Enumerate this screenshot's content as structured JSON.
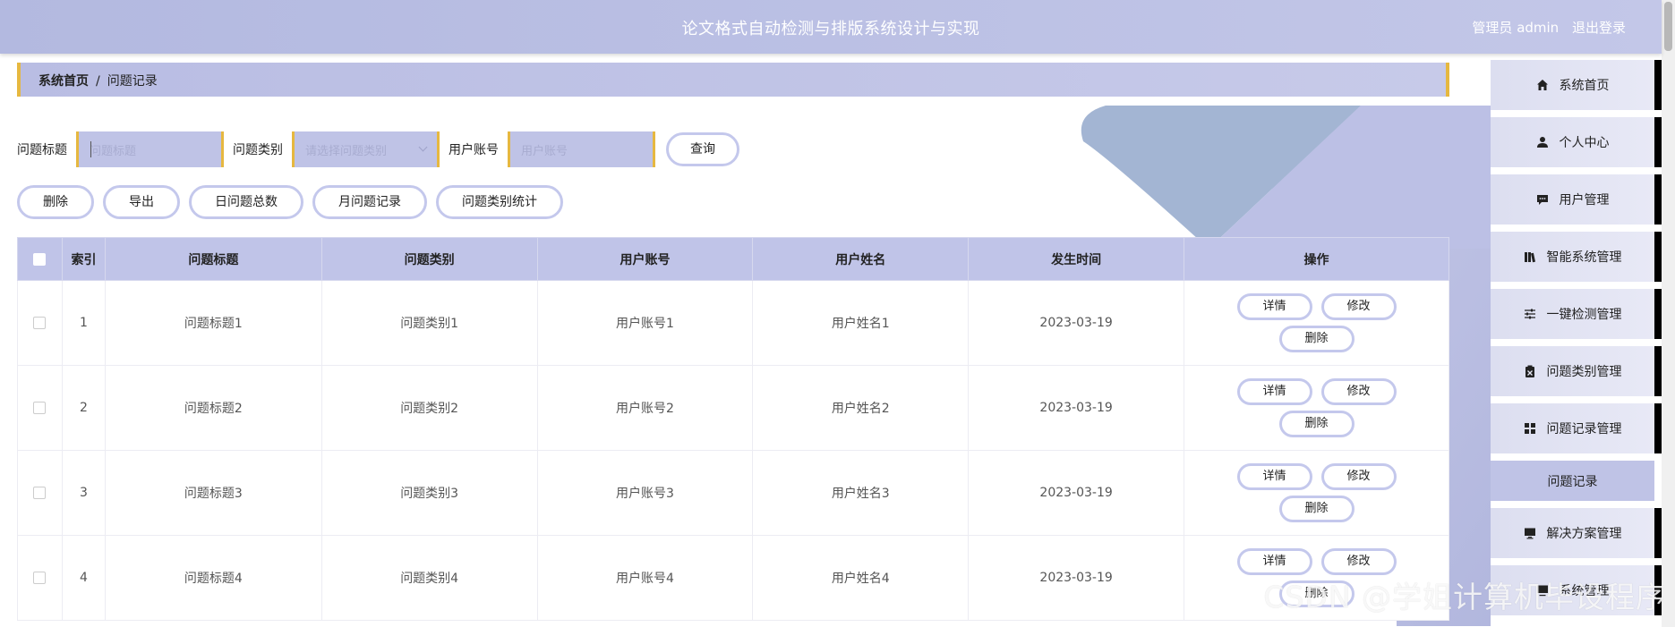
{
  "header": {
    "title": "论文格式自动检测与排版系统设计与实现",
    "user_label": "管理员 admin",
    "logout": "退出登录"
  },
  "breadcrumb": {
    "home": "系统首页",
    "separator": "/",
    "current": "问题记录"
  },
  "search": {
    "title_label": "问题标题",
    "title_placeholder": "问题标题",
    "category_label": "问题类别",
    "category_placeholder": "请选择问题类别",
    "account_label": "用户账号",
    "account_placeholder": "用户账号",
    "query_button": "查询"
  },
  "actions": [
    "删除",
    "导出",
    "日问题总数",
    "月问题记录",
    "问题类别统计"
  ],
  "table": {
    "headers": [
      "索引",
      "问题标题",
      "问题类别",
      "用户账号",
      "用户姓名",
      "发生时间",
      "操作"
    ],
    "rows": [
      {
        "index": "1",
        "title": "问题标题1",
        "category": "问题类别1",
        "account": "用户账号1",
        "name": "用户姓名1",
        "time": "2023-03-19"
      },
      {
        "index": "2",
        "title": "问题标题2",
        "category": "问题类别2",
        "account": "用户账号2",
        "name": "用户姓名2",
        "time": "2023-03-19"
      },
      {
        "index": "3",
        "title": "问题标题3",
        "category": "问题类别3",
        "account": "用户账号3",
        "name": "用户姓名3",
        "time": "2023-03-19"
      },
      {
        "index": "4",
        "title": "问题标题4",
        "category": "问题类别4",
        "account": "用户账号4",
        "name": "用户姓名4",
        "time": "2023-03-19"
      }
    ],
    "row_ops": {
      "detail": "详情",
      "edit": "修改",
      "delete": "删除"
    }
  },
  "sidebar": {
    "items": [
      {
        "label": "系统首页",
        "icon": "home-icon"
      },
      {
        "label": "个人中心",
        "icon": "user-icon"
      },
      {
        "label": "用户管理",
        "icon": "chat-icon"
      },
      {
        "label": "智能系统管理",
        "icon": "books-icon"
      },
      {
        "label": "一键检测管理",
        "icon": "sliders-icon"
      },
      {
        "label": "问题类别管理",
        "icon": "clipboard-icon"
      },
      {
        "label": "问题记录管理",
        "icon": "grid-icon"
      }
    ],
    "sub_item": "问题记录",
    "items_after": [
      {
        "label": "解决方案管理",
        "icon": "monitor-icon"
      },
      {
        "label": "系统管理",
        "icon": "settings-icon"
      }
    ]
  },
  "watermark": "CSDN @学姐计算机毕设程序",
  "colors": {
    "header_bg": "#b3b9e0",
    "accent_gold": "#e6b840",
    "pill_border": "#c4c8ec",
    "table_header_bg": "#c0c4e8"
  }
}
